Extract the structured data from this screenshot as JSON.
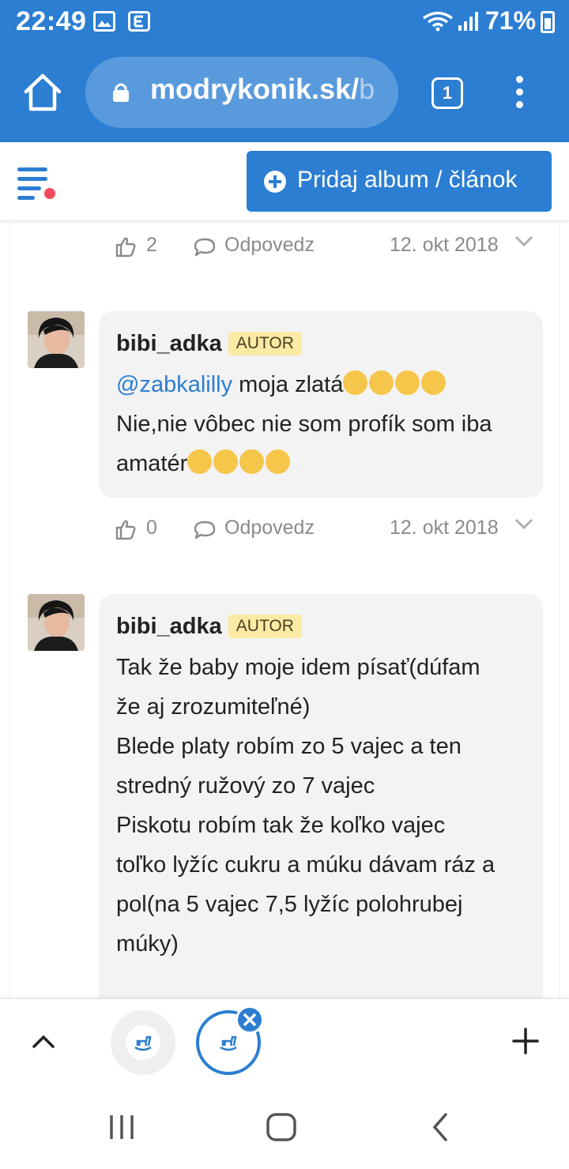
{
  "status_bar": {
    "time": "22:49",
    "battery": "71%",
    "icons": [
      "gallery-icon",
      "e-notification-icon",
      "wifi-icon",
      "signal-icon",
      "battery-icon"
    ]
  },
  "browser": {
    "url_main": "modrykonik.sk/",
    "url_tail": "b",
    "tab_count": "1",
    "accent_color": "#2b7ed2"
  },
  "site_header": {
    "add_button_label": "Pridaj album / článok"
  },
  "comments": [
    {
      "likes": "2",
      "reply_label": "Odpovedz",
      "date": "12. okt 2018"
    },
    {
      "author": "bibi_adka",
      "badge": "AUTOR",
      "mention": "@zabkalilly",
      "text_line1_after_mention": " moja zlatá",
      "text_line2": "Nie,nie vôbec nie som profík som iba",
      "text_line3": "amatér",
      "likes": "0",
      "reply_label": "Odpovedz",
      "date": "12. okt 2018"
    },
    {
      "author": "bibi_adka",
      "badge": "AUTOR",
      "lines": [
        "Tak že baby moje idem písať(dúfam",
        "že aj zrozumiteľné)",
        "Blede platy robím zo 5 vajec a ten",
        "stredný ružový zo 7 vajec",
        "Piskotu robím tak že koľko vajec",
        "toľko lyžíc cukru a múku dávam ráz a",
        "pol(na 5 vajec 7,5 lyžíc polohrubej",
        "múky)"
      ]
    }
  ]
}
